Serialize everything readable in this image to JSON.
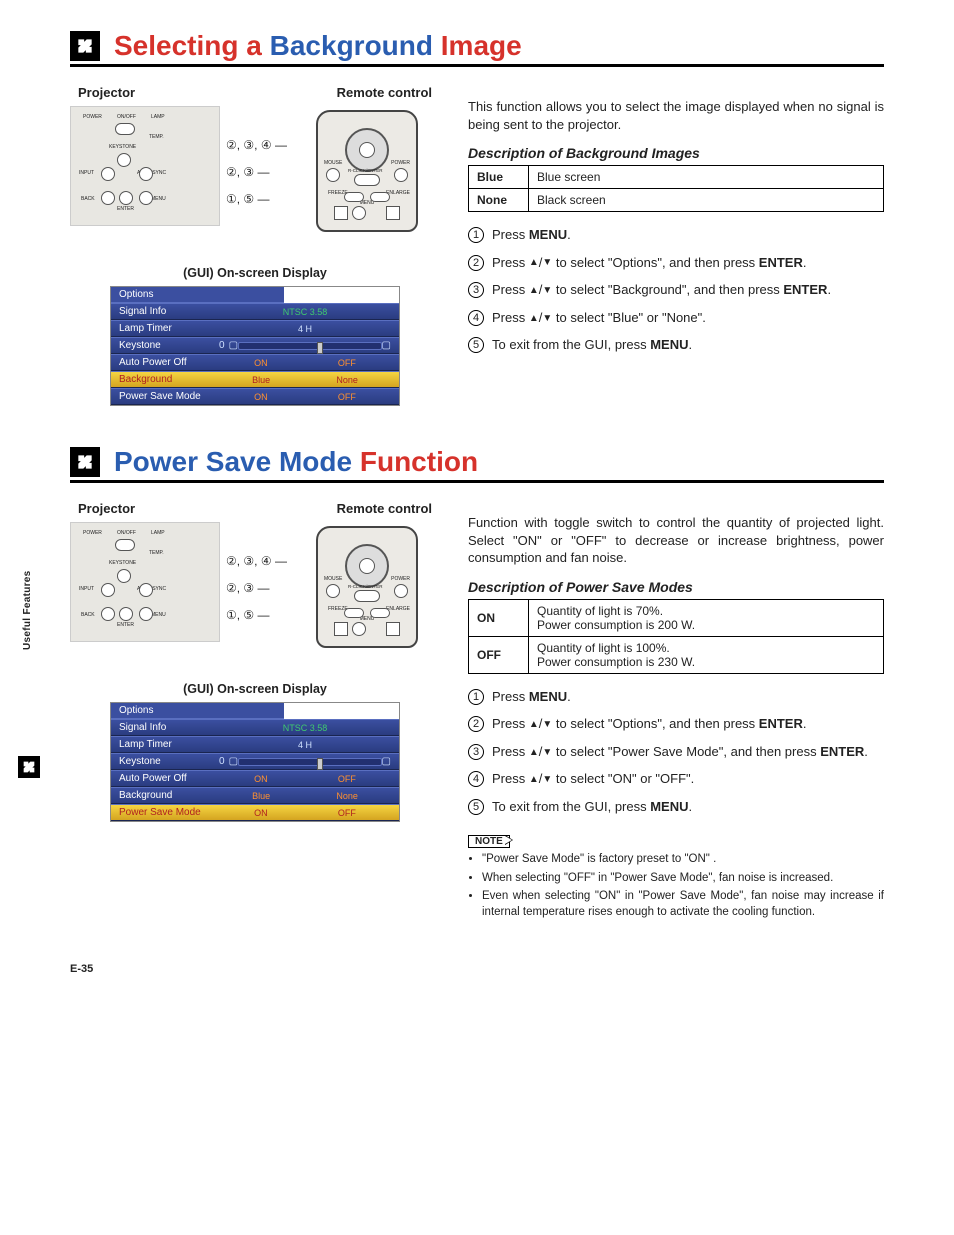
{
  "page_number": "E-35",
  "side_tab_label": "Useful Features",
  "projector_label": "Projector",
  "remote_label": "Remote control",
  "gui_display_label": "(GUI) On-screen Display",
  "callouts": {
    "row1": "②, ③, ④",
    "row2": "②, ③",
    "row3": "①, ⑤"
  },
  "gui": {
    "tab": "Options",
    "signal_info": "Signal Info",
    "signal_val": "NTSC 3.58",
    "lamp_timer": "Lamp Timer",
    "lamp_val": "4 H",
    "keystone": "Keystone",
    "keystone_val": "0",
    "auto_power_off": "Auto Power Off",
    "on": "ON",
    "off": "OFF",
    "background": "Background",
    "blue": "Blue",
    "none": "None",
    "power_save": "Power Save Mode"
  },
  "section1": {
    "title_pre": "Selecting a ",
    "title_accent": "Background",
    "title_post": " Image",
    "intro": "This function allows you to select the image displayed when no signal is being sent to the projector.",
    "desc_title": "Description of Background Images",
    "table": [
      {
        "k": "Blue",
        "v": "Blue screen"
      },
      {
        "k": "None",
        "v": "Black screen"
      }
    ],
    "steps": [
      {
        "n": "1",
        "html": "Press <b>MENU</b>."
      },
      {
        "n": "2",
        "html": "Press <span class='arr'>▲</span>/<span class='arr'>▼</span> to select \"Options\", and then press <b>ENTER</b>."
      },
      {
        "n": "3",
        "html": "Press <span class='arr'>▲</span>/<span class='arr'>▼</span> to select \"Background\", and then press <b>ENTER</b>."
      },
      {
        "n": "4",
        "html": "Press <span class='arr'>▲</span>/<span class='arr'>▼</span> to select \"Blue\" or \"None\"."
      },
      {
        "n": "5",
        "html": "To exit from the GUI, press <b>MENU</b>."
      }
    ]
  },
  "section2": {
    "title_pre": "",
    "title_accent": "Power Save Mode",
    "title_post": " Function",
    "intro": "Function with toggle switch to control the quantity of projected light. Select \"ON\" or \"OFF\" to decrease or increase brightness, power consumption and fan noise.",
    "desc_title": "Description of Power Save Modes",
    "table": [
      {
        "k": "ON",
        "v": "Quantity of light is 70%.\nPower consumption is 200 W."
      },
      {
        "k": "OFF",
        "v": "Quantity of light is 100%.\nPower consumption is 230 W."
      }
    ],
    "steps": [
      {
        "n": "1",
        "html": "Press <b>MENU</b>."
      },
      {
        "n": "2",
        "html": "Press <span class='arr'>▲</span>/<span class='arr'>▼</span> to select \"Options\", and then press <b>ENTER</b>."
      },
      {
        "n": "3",
        "html": "Press <span class='arr'>▲</span>/<span class='arr'>▼</span> to select \"Power Save Mode\", and then press <b>ENTER</b>."
      },
      {
        "n": "4",
        "html": "Press <span class='arr'>▲</span>/<span class='arr'>▼</span> to select \"ON\" or \"OFF\"."
      },
      {
        "n": "5",
        "html": "To exit from the GUI, press <b>MENU</b>."
      }
    ],
    "note_label": "NOTE",
    "notes": [
      "\"Power Save Mode\" is factory preset to \"ON\" .",
      "When selecting \"OFF\" in \"Power Save Mode\", fan noise is increased.",
      "Even when selecting \"ON\" in \"Power Save Mode\", fan noise may increase if internal temperature rises enough to activate the cooling function."
    ]
  }
}
